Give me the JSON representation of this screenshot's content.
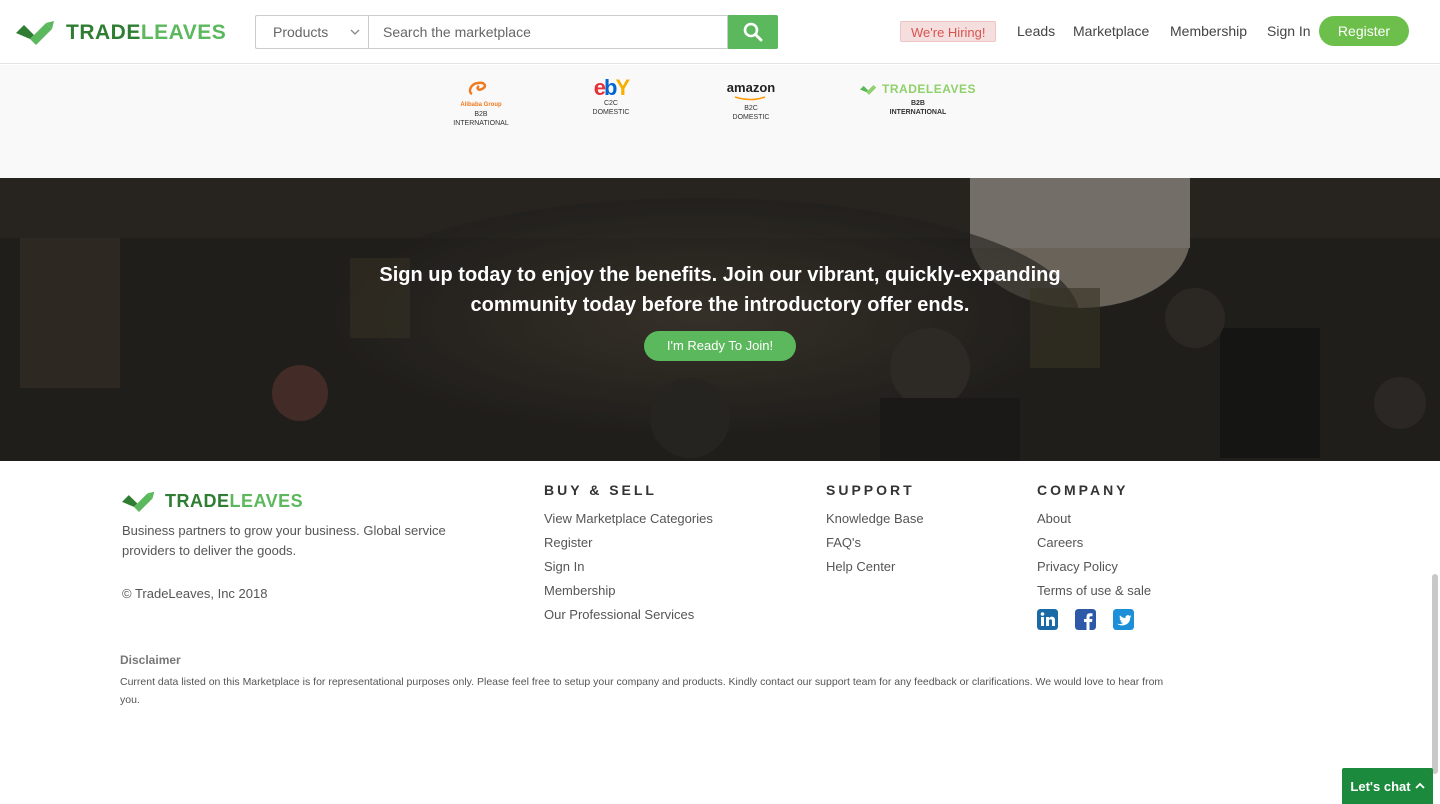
{
  "header": {
    "logo_part1": "TRADE",
    "logo_part2": "LEAVES",
    "search_category": "Products",
    "search_placeholder": "Search the marketplace",
    "hiring_label": "We're Hiring!",
    "nav": [
      "Leads",
      "Marketplace",
      "Membership",
      "Sign In"
    ],
    "register_label": "Register"
  },
  "partners": [
    {
      "name": "Alibaba Group",
      "line1": "B2B",
      "line2": "INTERNATIONAL"
    },
    {
      "name": "ebY",
      "line1": "C2C",
      "line2": "DOMESTIC"
    },
    {
      "name": "amazon",
      "line1": "B2C",
      "line2": "DOMESTIC"
    },
    {
      "name": "TRADELEAVES",
      "line1": "B2B",
      "line2": "INTERNATIONAL"
    }
  ],
  "hero": {
    "line1": "Sign up today to enjoy the benefits. Join our vibrant, quickly-expanding",
    "line2": "community today before the introductory offer ends.",
    "cta_label": "I'm Ready To Join!"
  },
  "footer": {
    "tagline": "Business partners to grow your business. Global service providers to deliver the goods.",
    "copyright": "© TradeLeaves, Inc 2018",
    "columns": [
      {
        "heading": "BUY & SELL",
        "links": [
          "View Marketplace Categories",
          "Register",
          "Sign In",
          "Membership",
          "Our Professional Services"
        ]
      },
      {
        "heading": "SUPPORT",
        "links": [
          "Knowledge Base",
          "FAQ's",
          "Help Center"
        ]
      },
      {
        "heading": "COMPANY",
        "links": [
          "About",
          "Careers",
          "Privacy Policy",
          "Terms of use & sale"
        ]
      }
    ],
    "social_icons": [
      "linkedin-icon",
      "facebook-icon",
      "twitter-icon"
    ],
    "disclaimer_heading": "Disclaimer",
    "disclaimer_text": "Current data listed on this Marketplace is for representational purposes only. Please feel free to setup your company and products. Kindly contact our support team for any feedback or clarifications. We would love to hear from you."
  },
  "chat": {
    "label": "Let's chat"
  },
  "colors": {
    "brand_green": "#5cb85c",
    "brand_dark_green": "#2e7d32",
    "hiring_red": "#d9534f",
    "chat_green": "#1b8a3c"
  }
}
